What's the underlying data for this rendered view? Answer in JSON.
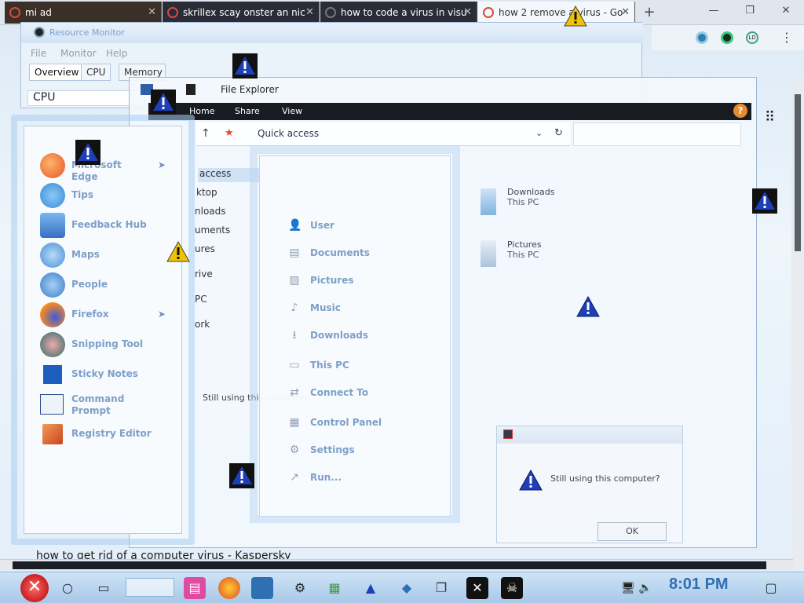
{
  "browser": {
    "tabs": [
      {
        "title": "mi   ad"
      },
      {
        "title": "skrillex scay onster an nic"
      },
      {
        "title": "how to code a virus in visu"
      },
      {
        "title": "how 2 remove a virus - Go"
      }
    ],
    "new_tab_glyph": "+",
    "minimize_glyph": "—",
    "restore_glyph": "❐",
    "close_glyph": "✕",
    "menu_glyph": "⋮",
    "ext_badge": "LD"
  },
  "resource_monitor": {
    "title": "Resource Monitor",
    "menu": [
      "File",
      "Monitor",
      "Help"
    ],
    "tabs": [
      "Overview",
      "CPU",
      "Memory"
    ],
    "cpu_section": "CPU"
  },
  "explorer": {
    "title": "File Explorer",
    "ribbon": [
      "Home",
      "Share",
      "View"
    ],
    "help_glyph": "?",
    "address": "Quick access",
    "nav_items": [
      "access",
      "ktop",
      "nloads",
      "uments",
      "ures",
      "rive",
      "PC",
      "ork"
    ],
    "quick_items": [
      {
        "name": "Downloads",
        "location": "This PC"
      },
      {
        "name": "Pictures",
        "location": "This PC"
      }
    ],
    "status_text": "Still using this computer?"
  },
  "start_menu": {
    "items": [
      {
        "label": "Microsoft Edge",
        "icon": "edge-icon",
        "arrow": true,
        "color": "#2a8fd8"
      },
      {
        "label": "Tips",
        "icon": "lightbulb-icon",
        "arrow": false,
        "color": "#4aa3e8"
      },
      {
        "label": "Feedback Hub",
        "icon": "feedback-icon",
        "arrow": false,
        "color": "#3b7fd0"
      },
      {
        "label": "Maps",
        "icon": "map-pin-icon",
        "arrow": false,
        "color": "#3a8ad8"
      },
      {
        "label": "People",
        "icon": "people-icon",
        "arrow": false,
        "color": "#3c86d2"
      },
      {
        "label": "Firefox",
        "icon": "firefox-icon",
        "arrow": true,
        "color": "#e66000"
      },
      {
        "label": "Snipping Tool",
        "icon": "scissors-icon",
        "arrow": false,
        "color": "#c23a3a"
      },
      {
        "label": "Sticky Notes",
        "icon": "sticky-note-icon",
        "arrow": false,
        "color": "#1d5fbf"
      },
      {
        "label": "Command Prompt",
        "icon": "terminal-icon",
        "arrow": false,
        "color": "#2d4d8a"
      },
      {
        "label": "Registry Editor",
        "icon": "registry-icon",
        "arrow": false,
        "color": "#d8612c"
      }
    ],
    "arrow_glyph": "➤"
  },
  "places": {
    "items": [
      {
        "label": "User",
        "icon": "user-icon",
        "glyph": "👤"
      },
      {
        "label": "Documents",
        "icon": "document-icon",
        "glyph": "▤"
      },
      {
        "label": "Pictures",
        "icon": "picture-icon",
        "glyph": "▨"
      },
      {
        "label": "Music",
        "icon": "music-icon",
        "glyph": "♪"
      },
      {
        "label": "Downloads",
        "icon": "download-icon",
        "glyph": "⭳"
      },
      {
        "label": "This PC",
        "icon": "computer-icon",
        "glyph": "▭"
      },
      {
        "label": "Connect To",
        "icon": "network-icon",
        "glyph": "⇄"
      },
      {
        "label": "Control Panel",
        "icon": "control-panel-icon",
        "glyph": "▦"
      },
      {
        "label": "Settings",
        "icon": "gear-icon",
        "glyph": "⚙"
      },
      {
        "label": "Run...",
        "icon": "run-icon",
        "glyph": "↗"
      }
    ]
  },
  "dialog": {
    "message": "Still using this computer?",
    "ok_label": "OK"
  },
  "taskbar": {
    "time": "8:01 PM",
    "bottom_text": "how to get rid of a computer virus - Kaspersky"
  },
  "colors": {
    "accent": "#2f6fb3",
    "warning_blue": "#1d3fb8",
    "warning_yellow": "#f2c200"
  }
}
